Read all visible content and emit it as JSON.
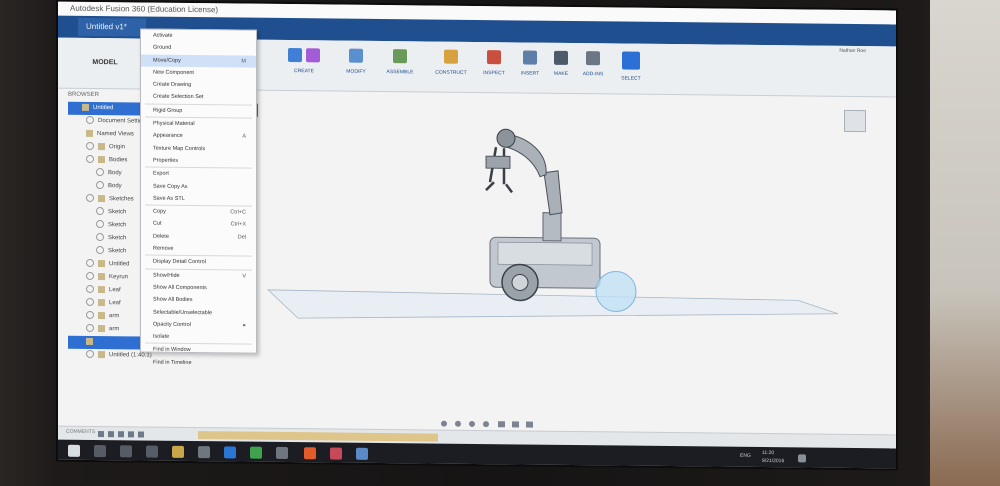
{
  "window": {
    "title": "Autodesk Fusion 360 (Education License)"
  },
  "document_tab": {
    "label": "Untitled v1*"
  },
  "ribbon": {
    "mode": "MODEL",
    "groups": [
      "CREATE",
      "MODIFY",
      "ASSEMBLE",
      "CONSTRUCT",
      "INSPECT",
      "INSERT",
      "MAKE",
      "ADD-INS",
      "SELECT"
    ],
    "user": "Nathan Roe"
  },
  "browser": {
    "header": "BROWSER",
    "rows": [
      "Untitled",
      "Document Settings",
      "Named Views",
      "Origin",
      "Bodies",
      "Body",
      "Body",
      "Sketches",
      "Sketch",
      "Sketch",
      "Sketch",
      "Sketch",
      "Untitled",
      "Keyrun",
      "Leaf",
      "Leaf",
      "arm",
      "arm",
      "",
      "Untitled (1:40.1)"
    ]
  },
  "context_menu": {
    "items": [
      {
        "label": "Activate",
        "shortcut": ""
      },
      {
        "label": "Ground",
        "shortcut": ""
      },
      {
        "label": "Move/Copy",
        "shortcut": "M"
      },
      {
        "label": "New Component",
        "shortcut": ""
      },
      {
        "label": "Create Drawing",
        "shortcut": ""
      },
      {
        "label": "Create Selection Set",
        "shortcut": ""
      },
      {
        "label": "Rigid Group",
        "shortcut": ""
      },
      {
        "label": "Physical Material",
        "shortcut": ""
      },
      {
        "label": "Appearance",
        "shortcut": "A"
      },
      {
        "label": "Texture Map Controls",
        "shortcut": ""
      },
      {
        "label": "Properties",
        "shortcut": ""
      },
      {
        "label": "Export",
        "shortcut": ""
      },
      {
        "label": "Save Copy As",
        "shortcut": ""
      },
      {
        "label": "Save As STL",
        "shortcut": ""
      },
      {
        "label": "Copy",
        "shortcut": "Ctrl+C"
      },
      {
        "label": "Cut",
        "shortcut": "Ctrl+X"
      },
      {
        "label": "Delete",
        "shortcut": "Del"
      },
      {
        "label": "Remove",
        "shortcut": ""
      },
      {
        "label": "Display Detail Control",
        "shortcut": ""
      },
      {
        "label": "Show/Hide",
        "shortcut": "V"
      },
      {
        "label": "Show All Components",
        "shortcut": ""
      },
      {
        "label": "Show All Bodies",
        "shortcut": ""
      },
      {
        "label": "Selectable/Unselectable",
        "shortcut": ""
      },
      {
        "label": "Opacity Control",
        "shortcut": ""
      },
      {
        "label": "Isolate",
        "shortcut": ""
      },
      {
        "label": "Find in Window",
        "shortcut": ""
      },
      {
        "label": "Find in Timeline",
        "shortcut": ""
      }
    ]
  },
  "timeline": {
    "comments_label": "COMMENTS"
  },
  "taskbar": {
    "language": "ENG",
    "time": "11:20",
    "date": "9/21/2016"
  },
  "colors": {
    "accent": "#1f4f8f",
    "selection": "#2f6fd1",
    "menu_highlight": "#cfe0f7"
  }
}
